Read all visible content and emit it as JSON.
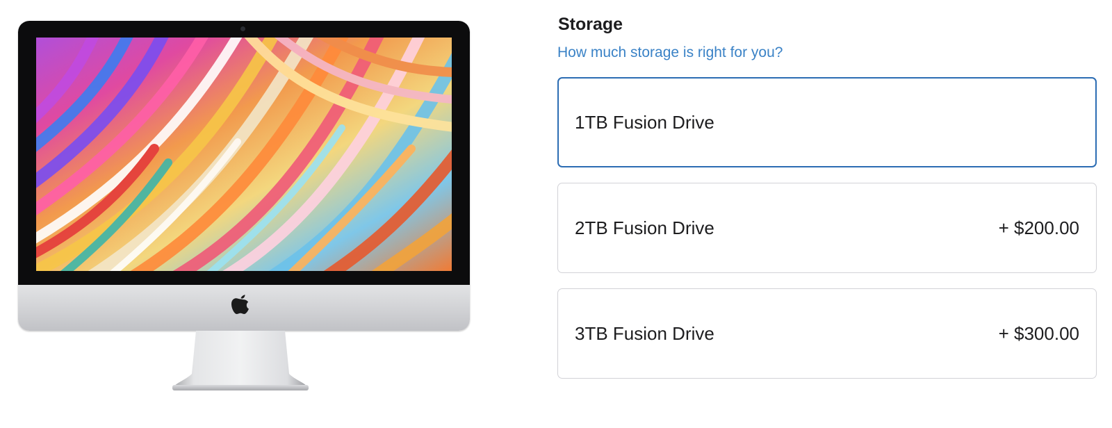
{
  "storage": {
    "title": "Storage",
    "help_link": "How much storage is right for you?",
    "options": [
      {
        "label": "1TB Fusion Drive",
        "price": "",
        "selected": true
      },
      {
        "label": "2TB Fusion Drive",
        "price": "+ $200.00",
        "selected": false
      },
      {
        "label": "3TB Fusion Drive",
        "price": "+ $300.00",
        "selected": false
      }
    ]
  },
  "colors": {
    "accent": "#2b6cb3",
    "link": "#3a82c6",
    "text": "#1d1d1f",
    "border": "#d2d2d7"
  },
  "icons": {
    "brand": "apple-logo-icon"
  }
}
